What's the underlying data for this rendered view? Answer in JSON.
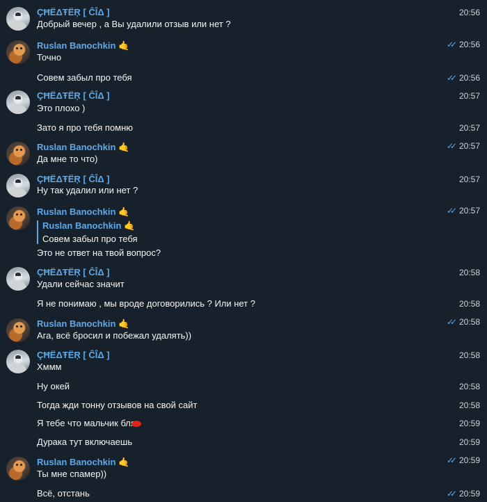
{
  "users": {
    "cheater": "ÇĦËΔŦËŖ [ ĈÎΔ ]",
    "ruslan": "Ruslan Banochkin",
    "ruslan_emoji": "🤙"
  },
  "reply": {
    "sender": "Ruslan Banochkin",
    "text": "Совем забыл про тебя"
  },
  "colors": {
    "background": "#17212b",
    "accent": "#5fa8e8",
    "text": "#f5f5f5",
    "redaction": "#e0261c"
  },
  "messages": [
    {
      "sender": "cheater",
      "text": "Добрый вечер , а Вы удалили отзыв или нет ?",
      "time": "20:56"
    },
    {
      "sender": "ruslan",
      "text": "Точно",
      "time": "20:56",
      "read": true
    },
    {
      "sender": "ruslan",
      "text": "Совем забыл про тебя",
      "time": "20:56",
      "read": true
    },
    {
      "sender": "cheater",
      "text": "Это плохо )",
      "time": "20:57"
    },
    {
      "sender": "cheater",
      "text": "Зато я про тебя помню",
      "time": "20:57"
    },
    {
      "sender": "ruslan",
      "text": "Да мне то что)",
      "time": "20:57",
      "read": true
    },
    {
      "sender": "cheater",
      "text": "Ну так удалил или нет ?",
      "time": "20:57"
    },
    {
      "sender": "ruslan",
      "text": "Это не ответ на твой вопрос?",
      "time": "20:57",
      "read": true
    },
    {
      "sender": "cheater",
      "text": "Удали сейчас значит",
      "time": "20:58"
    },
    {
      "sender": "cheater",
      "text": "Я не понимаю , мы вроде договорились ? Или нет ?",
      "time": "20:58"
    },
    {
      "sender": "ruslan",
      "text": "Ага, всё бросил и побежал удалять))",
      "time": "20:58",
      "read": true
    },
    {
      "sender": "cheater",
      "text": "Хммм",
      "time": "20:58"
    },
    {
      "sender": "cheater",
      "text": "Ну окей",
      "time": "20:58"
    },
    {
      "sender": "cheater",
      "text": "Тогда жди тонну отзывов на свой сайт",
      "time": "20:58"
    },
    {
      "sender": "cheater",
      "text": "Я тебе что мальчик бля",
      "time": "20:59"
    },
    {
      "sender": "cheater",
      "text": "Дурака тут включаешь",
      "time": "20:59"
    },
    {
      "sender": "ruslan",
      "text": "Ты мне спамер))",
      "time": "20:59",
      "read": true
    },
    {
      "sender": "ruslan",
      "text": "Всё, отстань",
      "time": "20:59",
      "read": true
    }
  ]
}
